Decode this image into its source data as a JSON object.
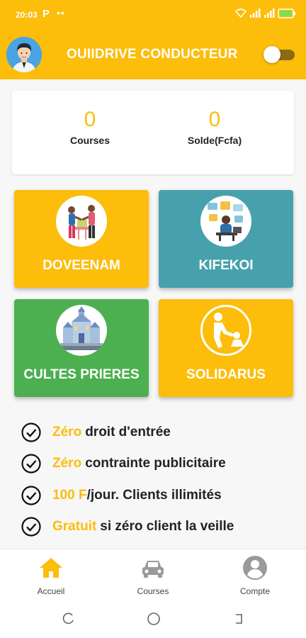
{
  "status_bar": {
    "time": "20:03",
    "p_badge": "P",
    "dots": "••"
  },
  "header": {
    "title": "OUIIDRIVE CONDUCTEUR",
    "toggle_on": false
  },
  "stats": [
    {
      "value": "0",
      "label": "Courses"
    },
    {
      "value": "0",
      "label": "Solde(Fcfa)"
    }
  ],
  "tiles": [
    {
      "label": "DOVEENAM",
      "color": "#fcbd0b",
      "icon": "handshake-people-icon"
    },
    {
      "label": "KIFEKOI",
      "color": "#47a1ac",
      "icon": "remote-work-icon"
    },
    {
      "label": "CULTES PRIERES",
      "color": "#4caf50",
      "icon": "church-icon"
    },
    {
      "label": "SOLIDARUS",
      "color": "#fcbd0b",
      "icon": "helping-hand-icon"
    }
  ],
  "features": [
    {
      "highlight": "Zéro",
      "text": "droit d'entrée"
    },
    {
      "highlight": "Zéro",
      "text": "contrainte publicitaire"
    },
    {
      "highlight": "100 F",
      "text": "/jour. Clients illimités"
    },
    {
      "highlight": "Gratuit",
      "text": "si zéro client la veille"
    }
  ],
  "bottom_nav": [
    {
      "label": "Accueil",
      "icon": "home-icon",
      "active": true
    },
    {
      "label": "Courses",
      "icon": "car-icon",
      "active": false
    },
    {
      "label": "Compte",
      "icon": "account-icon",
      "active": false
    }
  ],
  "colors": {
    "primary": "#fcbd0b",
    "teal": "#47a1ac",
    "green": "#4caf50"
  }
}
